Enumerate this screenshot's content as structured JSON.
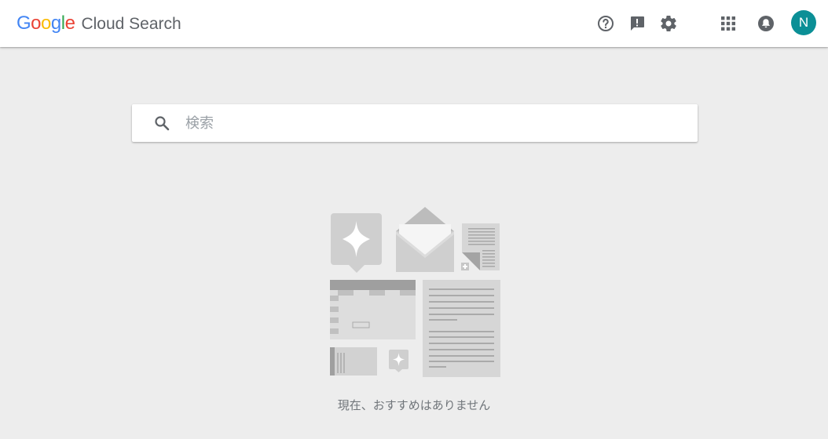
{
  "header": {
    "logo": {
      "letters": [
        "G",
        "o",
        "o",
        "g",
        "l",
        "e"
      ],
      "colors": [
        "#4285F4",
        "#EA4335",
        "#FBBC05",
        "#4285F4",
        "#34A853",
        "#EA4335"
      ],
      "product": "Cloud Search"
    },
    "icons": [
      "help-icon",
      "feedback-icon",
      "settings-icon",
      "apps-icon",
      "notifications-icon"
    ],
    "avatar_letter": "N",
    "avatar_color": "#0b8f96"
  },
  "search": {
    "placeholder": "検索",
    "value": ""
  },
  "empty_state": {
    "message": "現在、おすすめはありません"
  }
}
